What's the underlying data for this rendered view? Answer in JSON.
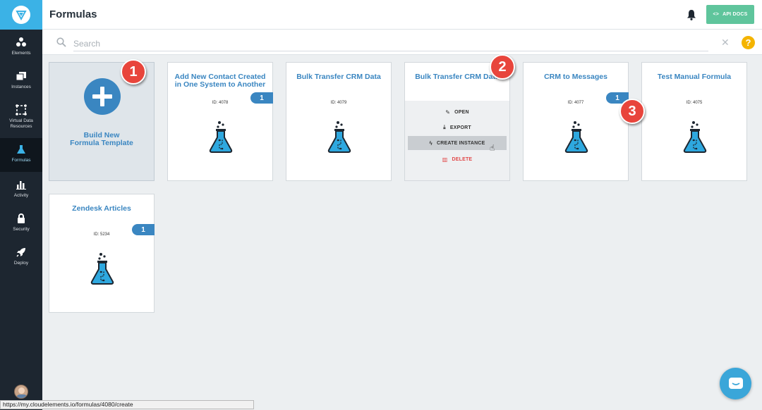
{
  "sidebar": {
    "items": [
      {
        "label": "Elements",
        "icon": "elements-icon"
      },
      {
        "label": "Instances",
        "icon": "instances-icon"
      },
      {
        "label": "Virtual Data Resources",
        "icon": "vdr-icon"
      },
      {
        "label": "Formulas",
        "icon": "flask-icon",
        "active": true
      },
      {
        "label": "Activity",
        "icon": "bar-chart-icon"
      },
      {
        "label": "Security",
        "icon": "lock-icon"
      },
      {
        "label": "Deploy",
        "icon": "rocket-icon"
      }
    ]
  },
  "header": {
    "title": "Formulas",
    "api_docs_label": "API DOCS"
  },
  "search": {
    "placeholder": "Search",
    "value": ""
  },
  "build_card": {
    "label": "Build New Formula Template"
  },
  "cards": [
    {
      "title": "Add New Contact Created in One System to Another",
      "id": "ID: 4078",
      "badge": "1"
    },
    {
      "title": "Bulk Transfer CRM Data",
      "id": "ID: 4079",
      "badge": ""
    },
    {
      "title": "Bulk Transfer CRM Data",
      "id": "",
      "badge": ""
    },
    {
      "title": "CRM to Messages",
      "id": "ID: 4077",
      "badge": "1"
    },
    {
      "title": "Test Manual Formula",
      "id": "ID: 4075",
      "badge": ""
    },
    {
      "title": "Zendesk Articles",
      "id": "ID: 5234",
      "badge": "1"
    }
  ],
  "card_menu": {
    "open": "OPEN",
    "export": "EXPORT",
    "create_instance": "CREATE INSTANCE",
    "delete": "DELETE"
  },
  "steps": [
    "1",
    "2",
    "3"
  ],
  "status_url": "https://my.cloudelements.io/formulas/4080/create",
  "colors": {
    "brand": "#3bb2e6",
    "sidebar": "#1d2630",
    "accent": "#3a86c1",
    "api_docs": "#5fc59c",
    "danger": "#e2494a",
    "step": "#e8453c",
    "help": "#f4b400"
  }
}
